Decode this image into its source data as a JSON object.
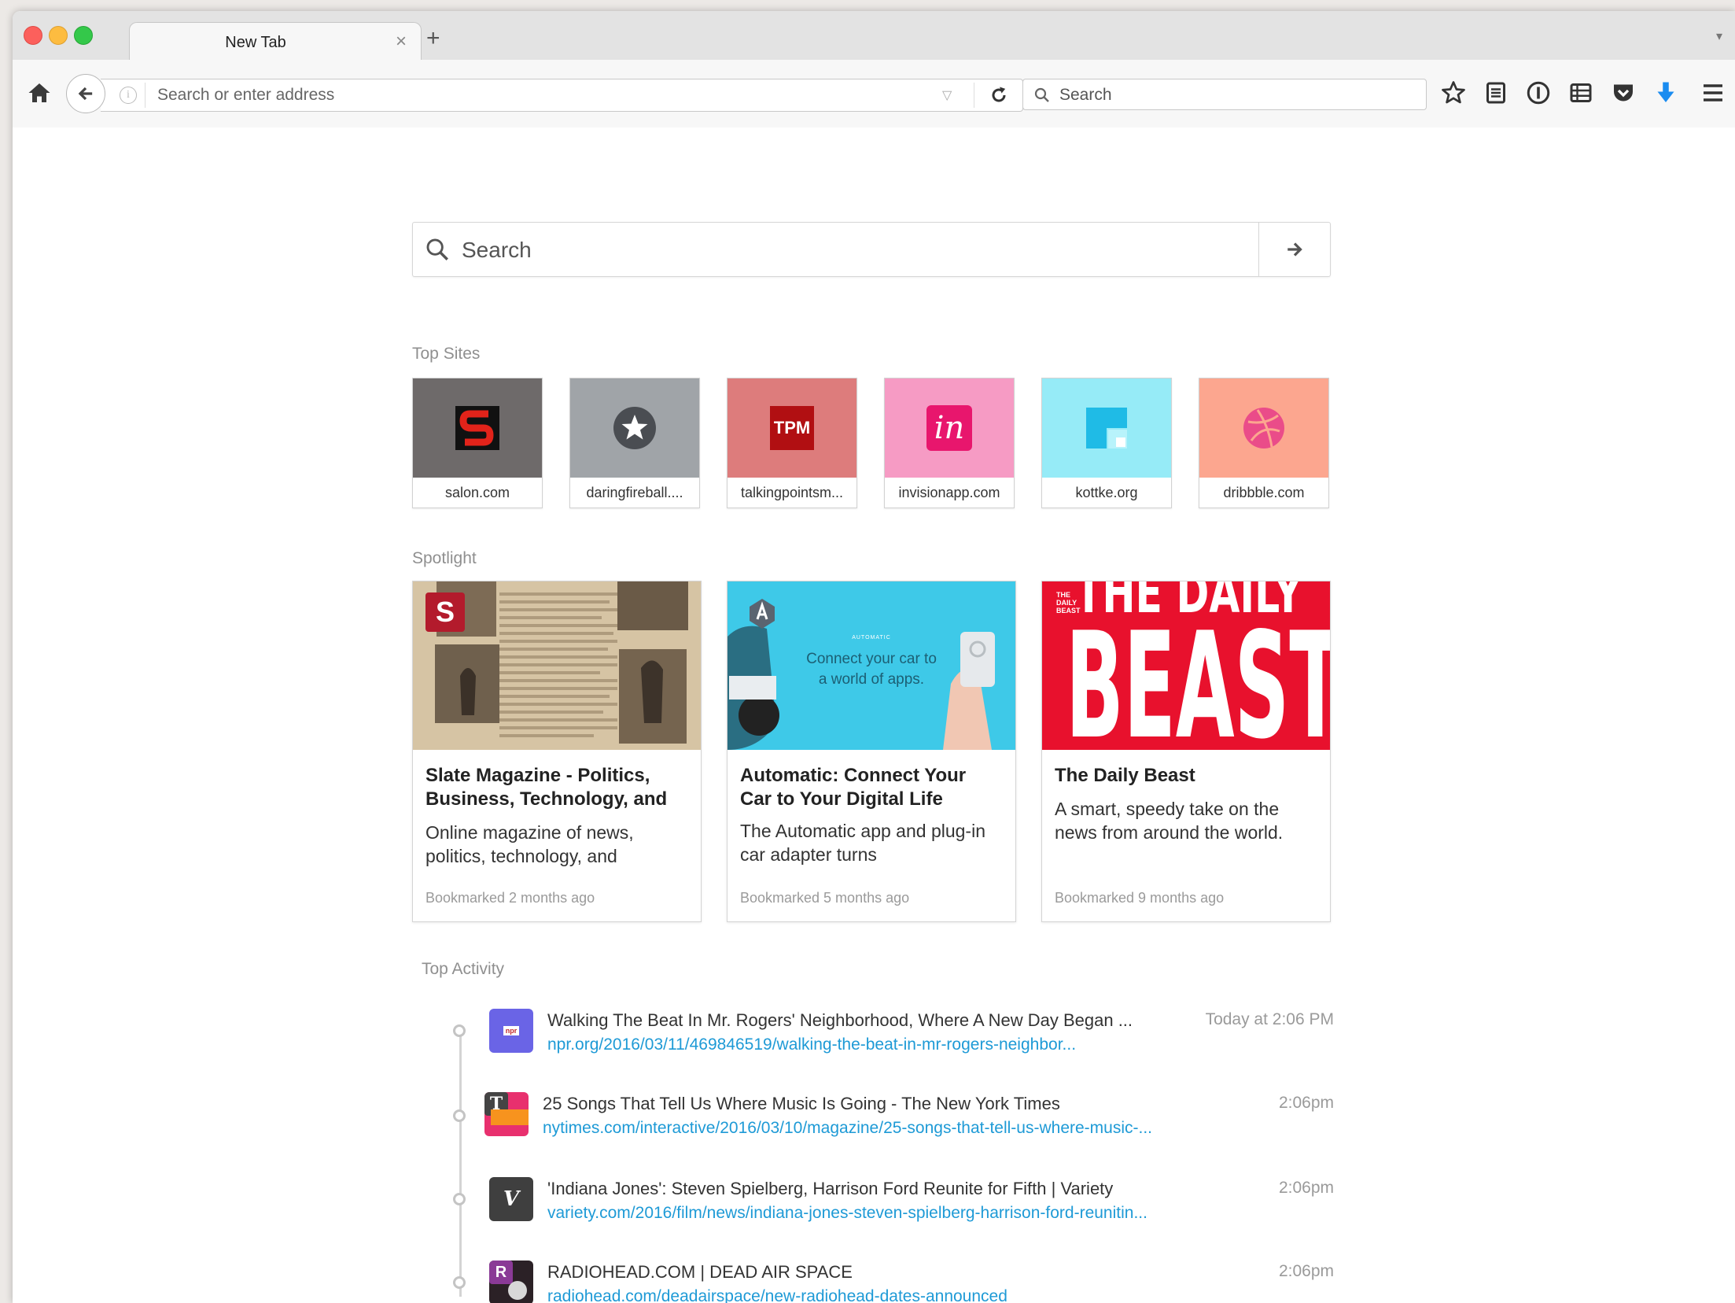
{
  "tab": {
    "title": "New Tab"
  },
  "navbar": {
    "url_placeholder": "Search or enter address",
    "search_placeholder": "Search"
  },
  "main_search": {
    "placeholder": "Search"
  },
  "top_sites": {
    "heading": "Top Sites",
    "items": [
      {
        "label": "salon.com",
        "bg": "#6e6a6a",
        "icon": "salon-logo-icon"
      },
      {
        "label": "daringfireball....",
        "bg": "#a0a4a8",
        "icon": "star-icon"
      },
      {
        "label": "talkingpointsm...",
        "bg": "#dd7c7c",
        "icon": "tpm-logo-icon",
        "icon_text": "TPM"
      },
      {
        "label": "invisionapp.com",
        "bg": "#f69bc4",
        "icon": "invision-logo-icon",
        "icon_text": "in"
      },
      {
        "label": "kottke.org",
        "bg": "#96ebf7",
        "icon": "kottke-logo-icon"
      },
      {
        "label": "dribbble.com",
        "bg": "#fca68f",
        "icon": "dribbble-logo-icon"
      }
    ]
  },
  "spotlight": {
    "heading": "Spotlight",
    "cards": [
      {
        "title": "Slate Magazine - Politics, Business, Technology, and",
        "description": "Online magazine of news, politics, technology, and",
        "meta": "Bookmarked 2 months ago",
        "badge": "S"
      },
      {
        "title": "Automatic: Connect Your Car to Your Digital Life",
        "description": "The Automatic app and plug-in car adapter turns",
        "meta": "Bookmarked 5 months ago",
        "overlay_brand": "AUTOMATIC",
        "overlay_text": "Connect your car to a world of apps."
      },
      {
        "title": "The Daily Beast",
        "description": "A smart, speedy take on the news from around the world.",
        "meta": "Bookmarked 9 months ago",
        "image_text_top": "THE DAILY",
        "image_text_big": "BEAST",
        "image_text_small": "THE DAILY BEAST"
      }
    ]
  },
  "top_activity": {
    "heading": "Top Activity",
    "items": [
      {
        "title": "Walking The Beat In Mr. Rogers' Neighborhood, Where A New Day Began ...",
        "url": "npr.org/2016/03/11/469846519/walking-the-beat-in-mr-rogers-neighbor...",
        "time": "Today at 2:06 PM",
        "icon": "npr-icon",
        "icon_text": "npr"
      },
      {
        "title": "25 Songs That Tell Us Where Music Is Going - The New York Times",
        "url": "nytimes.com/interactive/2016/03/10/magazine/25-songs-that-tell-us-where-music-...",
        "time": "2:06pm",
        "icon": "nytimes-icon",
        "icon_text": "T"
      },
      {
        "title": "'Indiana Jones': Steven Spielberg, Harrison Ford Reunite for Fifth | Variety",
        "url": "variety.com/2016/film/news/indiana-jones-steven-spielberg-harrison-ford-reunitin...",
        "time": "2:06pm",
        "icon": "variety-icon",
        "icon_text": "V"
      },
      {
        "title": "RADIOHEAD.COM | DEAD AIR SPACE",
        "url": "radiohead.com/deadairspace/new-radiohead-dates-announced",
        "time": "2:06pm",
        "icon": "radiohead-icon",
        "icon_text": "R"
      }
    ]
  },
  "colors": {
    "link": "#1e9ad6",
    "accent_download": "#1a8cf0",
    "daily_beast_red": "#e8112d"
  }
}
